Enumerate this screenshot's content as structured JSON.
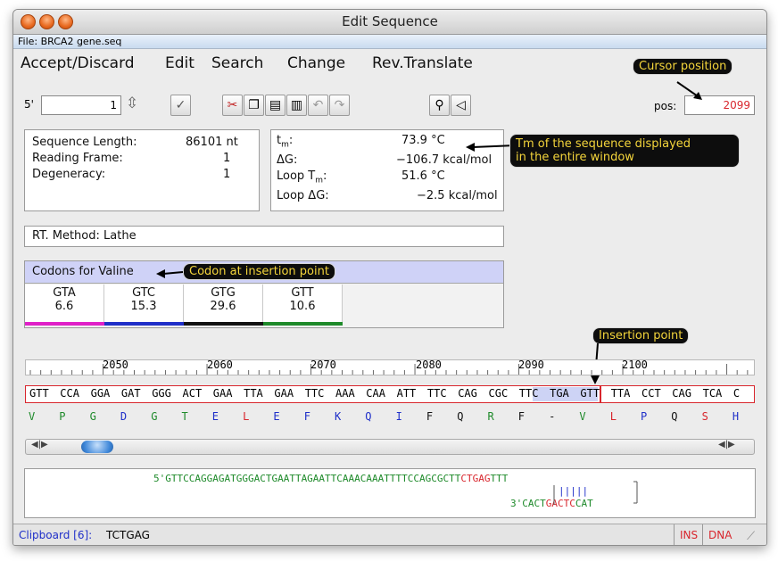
{
  "window": {
    "title": "Edit Sequence",
    "file": "File: BRCA2 gene.seq"
  },
  "menu": [
    "Accept/Discard",
    "Edit",
    "Search",
    "Change",
    "Rev.Translate"
  ],
  "toolbar": {
    "end_label": "5'",
    "position_value": "1",
    "pos_label": "pos:",
    "pos_value": "2099"
  },
  "stats": {
    "length_label": "Sequence Length:",
    "length_value": "86101 nt",
    "frame_label": "Reading Frame:",
    "frame_value": "1",
    "degeneracy_label": "Degeneracy:",
    "degeneracy_value": "1"
  },
  "tm": {
    "tm_label": "t",
    "tm_sub": "m",
    "tm_value": "73.9 °C",
    "dg_label": "ΔG:",
    "dg_value": "−106.7 kcal/mol",
    "looptm_label": "Loop T",
    "looptm_sub": "m",
    "looptm_value": "51.6 °C",
    "loopdg_label": "Loop ΔG:",
    "loopdg_value": "−2.5 kcal/mol"
  },
  "rt_method": "RT. Method: Lathe",
  "codons": {
    "title": "Codons for Valine",
    "items": [
      {
        "codon": "GTA",
        "value": "6.6",
        "color": "#e020c8"
      },
      {
        "codon": "GTC",
        "value": "15.3",
        "color": "#1f2fc9"
      },
      {
        "codon": "GTG",
        "value": "29.6",
        "color": "#111111"
      },
      {
        "codon": "GTT",
        "value": "10.6",
        "color": "#1e8a2a"
      }
    ]
  },
  "callouts": {
    "cursor": "Cursor position",
    "tm_line1": "Tm of the sequence displayed",
    "tm_line2": " in the entire window",
    "codon": "Codon at insertion point",
    "insertion": "Insertion point"
  },
  "ruler_labels": [
    "2050",
    "2060",
    "2070",
    "2080",
    "2090",
    "2100"
  ],
  "seq_line": [
    "GTT",
    "CCA",
    "GGA",
    "GAT",
    "GGG",
    "ACT",
    "GAA",
    "TTA",
    "GAA",
    "TTC",
    "AAA",
    "CAA",
    "ATT",
    "TTC",
    "CAG",
    "CGC",
    "TTC",
    "TGA",
    "GTT",
    "TTA",
    "CCT",
    "CAG",
    "TCA",
    "C"
  ],
  "aa_line": [
    {
      "aa": "V",
      "color": "#1e8a2a"
    },
    {
      "aa": "P",
      "color": "#1e8a2a"
    },
    {
      "aa": "G",
      "color": "#1e8a2a"
    },
    {
      "aa": "D",
      "color": "#1f2fc9"
    },
    {
      "aa": "G",
      "color": "#1e8a2a"
    },
    {
      "aa": "T",
      "color": "#1e8a2a"
    },
    {
      "aa": "E",
      "color": "#1f2fc9"
    },
    {
      "aa": "L",
      "color": "#d8262d"
    },
    {
      "aa": "E",
      "color": "#1f2fc9"
    },
    {
      "aa": "F",
      "color": "#1f2fc9"
    },
    {
      "aa": "K",
      "color": "#1f2fc9"
    },
    {
      "aa": "Q",
      "color": "#1f2fc9"
    },
    {
      "aa": "I",
      "color": "#1f2fc9"
    },
    {
      "aa": "F",
      "color": "#111111"
    },
    {
      "aa": "Q",
      "color": "#111111"
    },
    {
      "aa": "R",
      "color": "#1e8a2a"
    },
    {
      "aa": "F",
      "color": "#111111"
    },
    {
      "aa": "-",
      "color": "#111111"
    },
    {
      "aa": "V",
      "color": "#1e8a2a"
    },
    {
      "aa": "L",
      "color": "#d8262d"
    },
    {
      "aa": "P",
      "color": "#1f2fc9"
    },
    {
      "aa": "Q",
      "color": "#111111"
    },
    {
      "aa": "S",
      "color": "#d8262d"
    },
    {
      "aa": "H",
      "color": "#1f2fc9"
    }
  ],
  "hairpin": {
    "top_prefix": "5'GTTCCAGGAGATGGGACTGAATTAGAATTCAAACAAATTTTCCAGCGCTT",
    "top_highlight": "CTGAG",
    "top_suffix": "TTT",
    "pairs": "|||||",
    "bottom_prefix": "3'CACT",
    "bottom_highlight": "GACTC",
    "bottom_suffix": "CAT"
  },
  "status": {
    "clipboard_label": "Clipboard [6]:",
    "clipboard_value": "TCTGAG",
    "ins": "INS",
    "dna": "DNA"
  },
  "colors": {
    "accent_red": "#d8262d",
    "callout_bg": "#0d0d0d",
    "callout_text": "#f4d53b",
    "selection": "#cdd3f5"
  }
}
